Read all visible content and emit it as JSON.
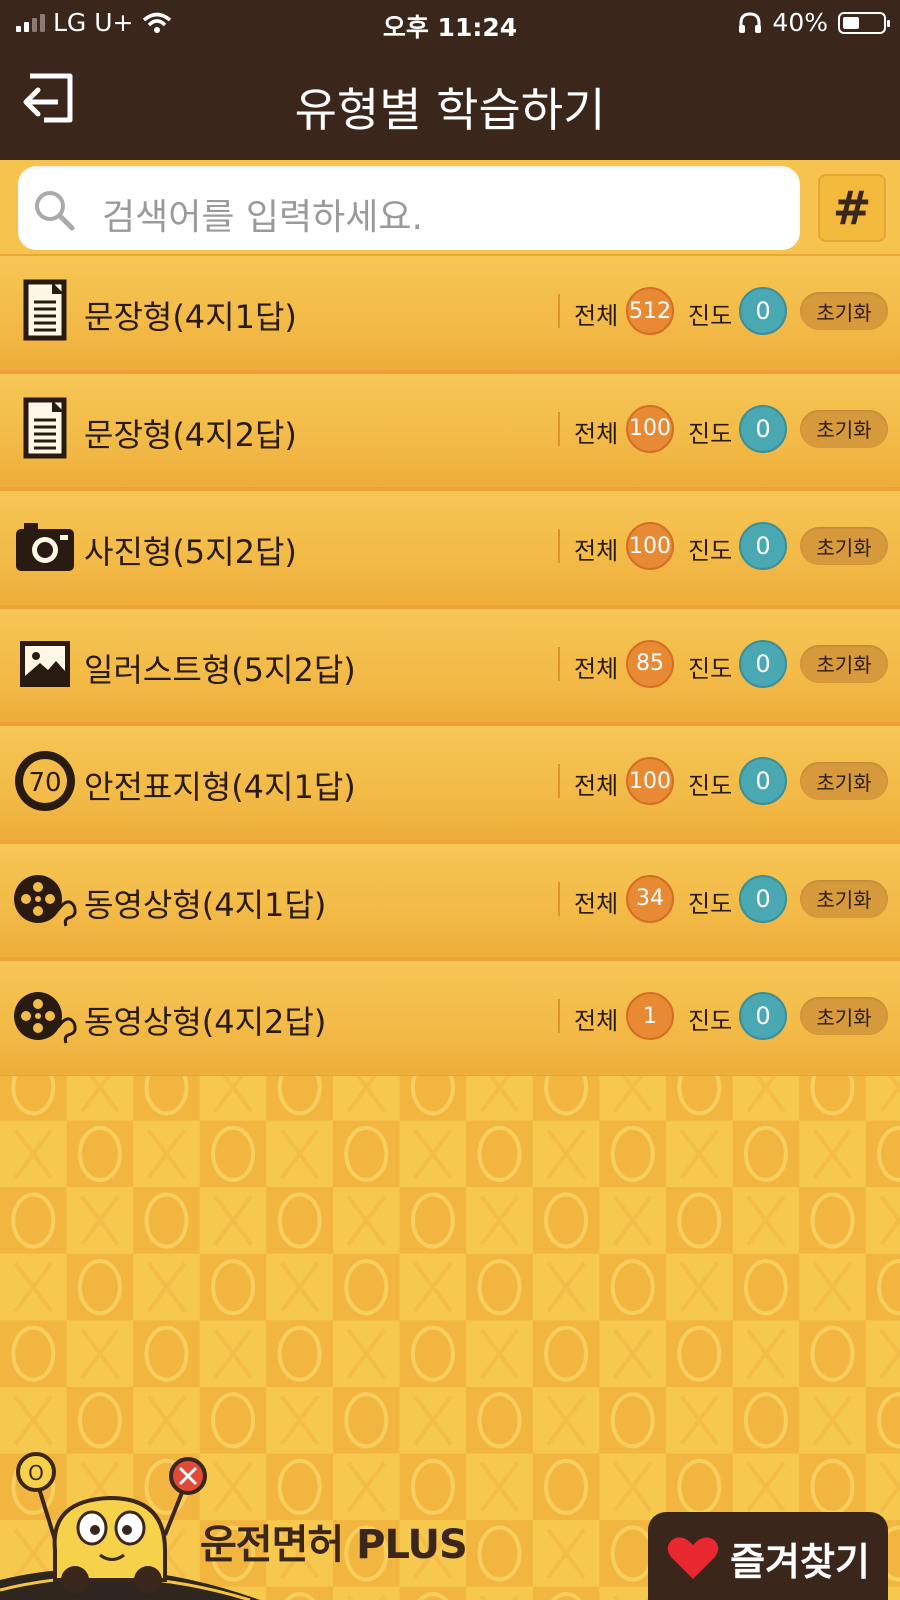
{
  "status_bar": {
    "carrier": "LG U+",
    "time": "오후 11:24",
    "battery": "40%",
    "icons": [
      "signal-icon",
      "wifi-icon",
      "headphones-icon",
      "battery-icon"
    ]
  },
  "header": {
    "title": "유형별 학습하기",
    "back_icon": "back-icon"
  },
  "search": {
    "placeholder": "검색어를 입력하세요.",
    "hash_label": "#"
  },
  "labels": {
    "total": "전체",
    "progress": "진도",
    "reset": "초기화"
  },
  "categories": [
    {
      "icon": "document-icon",
      "label": "문장형(4지1답)",
      "total": "512",
      "progress": "0"
    },
    {
      "icon": "document-icon",
      "label": "문장형(4지2답)",
      "total": "100",
      "progress": "0"
    },
    {
      "icon": "camera-icon",
      "label": "사진형(5지2답)",
      "total": "100",
      "progress": "0"
    },
    {
      "icon": "picture-icon",
      "label": "일러스트형(5지2답)",
      "total": "85",
      "progress": "0"
    },
    {
      "icon": "speed-sign-icon",
      "label": "안전표지형(4지1답)",
      "total": "100",
      "progress": "0"
    },
    {
      "icon": "film-reel-icon",
      "label": "동영상형(4지1답)",
      "total": "34",
      "progress": "0"
    },
    {
      "icon": "film-reel-icon",
      "label": "동영상형(4지2답)",
      "total": "1",
      "progress": "0"
    }
  ],
  "speed_sign_text": "70",
  "logo": {
    "text": "운전면허 PLUS"
  },
  "favorites": {
    "label": "즐겨찾기"
  },
  "colors": {
    "header_bg": "#3a261b",
    "row_bg": "#f3bb48",
    "total_badge": "#e88a33",
    "progress_badge": "#4aa8b3"
  }
}
